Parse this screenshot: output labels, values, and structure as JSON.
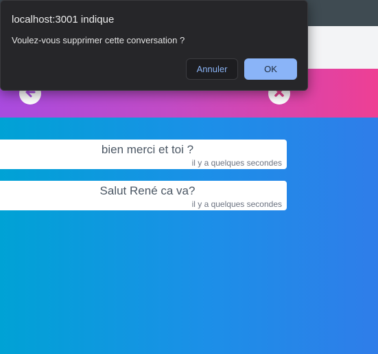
{
  "dialog": {
    "title": "localhost:3001 indique",
    "message": "Voulez-vous supprimer cette conversation ?",
    "cancel_label": "Annuler",
    "ok_label": "OK"
  },
  "header": {
    "back_icon": "arrow-left-icon",
    "close_icon": "close-icon",
    "accent_color": "#a94bdf"
  },
  "messages": [
    {
      "text": "bien merci et toi ?",
      "time": "il y a quelques secondes"
    },
    {
      "text": "Salut René ca va?",
      "time": "il y a quelques secondes"
    }
  ]
}
